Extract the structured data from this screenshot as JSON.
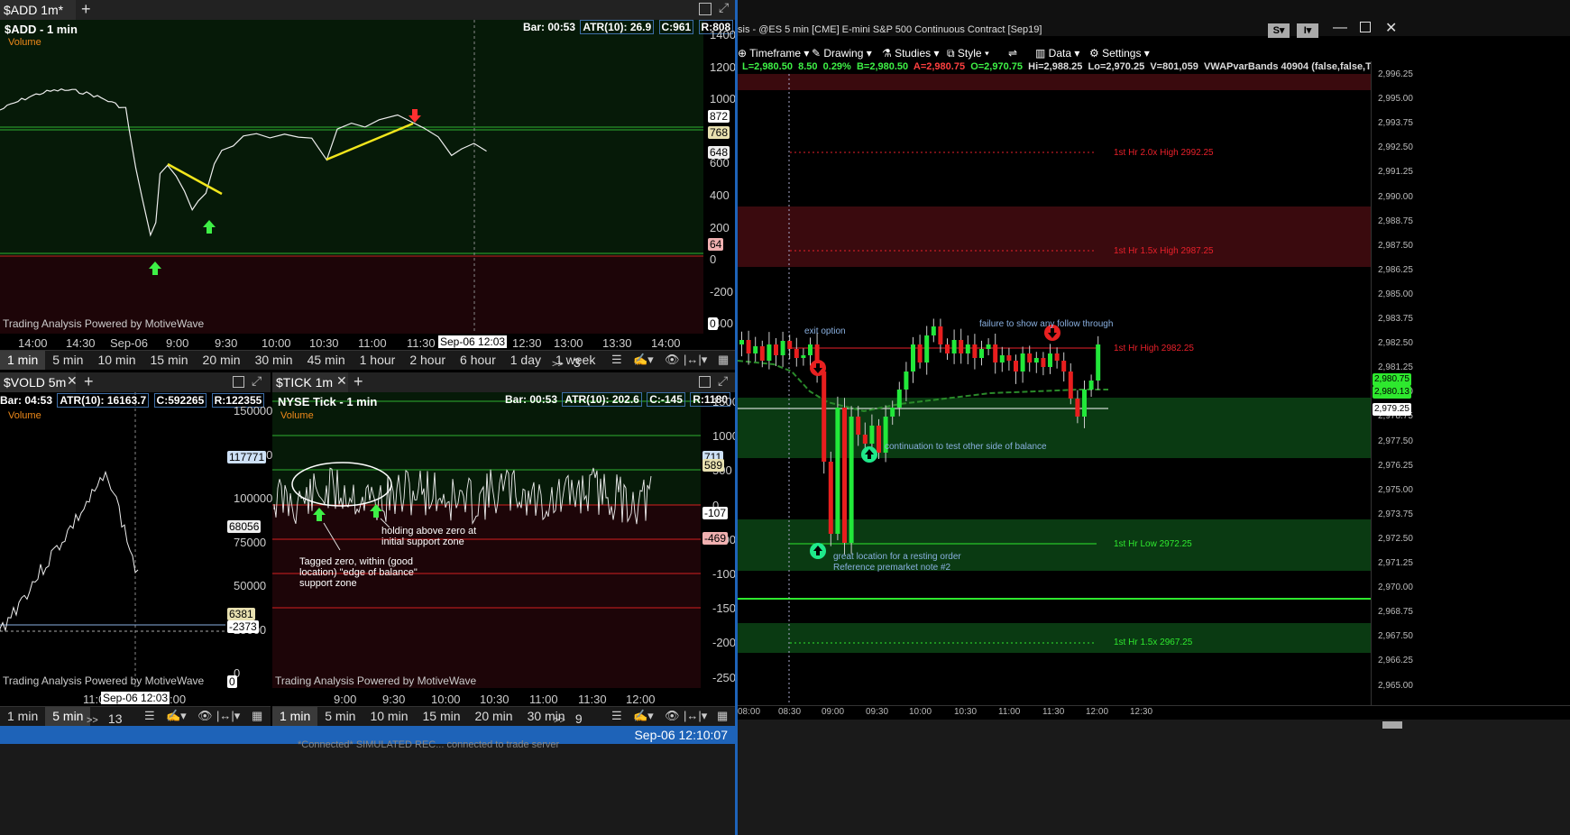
{
  "add_chart": {
    "tab_label": "$ADD 1m*",
    "title": "$ADD - 1 min",
    "volume_label": "Volume",
    "bar_info": "Bar: 00:53",
    "atr": "ATR(10): 26.9",
    "close": "C:961",
    "range": "R:808",
    "y_ticks": [
      "1400",
      "1200",
      "1000",
      "800",
      "600",
      "400",
      "200",
      "0",
      "-200",
      "-400"
    ],
    "tags": [
      "872",
      "768",
      "648",
      "64",
      "0"
    ],
    "x_ticks": [
      "14:00",
      "14:30",
      "Sep-06",
      "9:00",
      "9:30",
      "10:00",
      "10:30",
      "11:00",
      "11:30",
      "12:30",
      "13:00",
      "13:30",
      "14:00"
    ],
    "cursor_time": "Sep-06 12:03",
    "footer": "Trading Analysis Powered by MotiveWave",
    "timeframes": [
      "1 min",
      "5 min",
      "10 min",
      "15 min",
      "20 min",
      "30 min",
      "45 min",
      "1 hour",
      "2 hour",
      "6 hour",
      "1 day",
      "1 week"
    ],
    "more": "3"
  },
  "vold_chart": {
    "tab_label": "$VOLD 5m",
    "title": "$VOLD - 5 min",
    "volume_label": "Volume",
    "bar_info": "Bar: 04:53",
    "atr": "ATR(10): 16163.7",
    "close": "C:592265",
    "range": "R:122355",
    "y_ticks": [
      "150000",
      "125000",
      "100000",
      "75000",
      "50000",
      "25000",
      "0",
      "-25000"
    ],
    "tags": [
      "117771",
      "68056",
      "6381",
      "-2373",
      "0"
    ],
    "x_ticks": [
      "11:0",
      "Sep-06 12:03",
      ":00"
    ],
    "footer": "Trading Analysis Powered by MotiveWave",
    "timeframes": [
      "1 min",
      "5 min"
    ],
    "more": "13"
  },
  "tick_chart": {
    "tab_label": "$TICK 1m",
    "title": "NYSE Tick - 1 min",
    "volume_label": "Volume",
    "bar_info": "Bar: 00:53",
    "atr": "ATR(10): 202.6",
    "close": "C:-145",
    "range": "R:1180",
    "y_ticks": [
      "1500",
      "1000",
      "500",
      "0",
      "-500",
      "-1000",
      "-1500",
      "-2000",
      "-2500"
    ],
    "tags": [
      "711",
      "589",
      "-107",
      "-469"
    ],
    "x_ticks": [
      "9:00",
      "9:30",
      "10:00",
      "10:30",
      "11:00",
      "11:30",
      "12:00"
    ],
    "note1": "Tagged zero, within (good location) \"edge of balance\" support zone",
    "note2": "holding above zero at initial support zone",
    "footer": "Trading Analysis Powered by MotiveWave",
    "timeframes": [
      "1 min",
      "5 min",
      "10 min",
      "15 min",
      "20 min",
      "30 min"
    ],
    "more": "9"
  },
  "es_chart": {
    "title": "sis - @ES 5 min [CME] E-mini S&P 500 Continuous Contract [Sep19]",
    "toolbar": [
      "Timeframe",
      "Drawing",
      "Studies",
      "Style",
      "Data",
      "Settings"
    ],
    "quote": {
      "last": "L=2,980.50",
      "chg": "8.50",
      "pct": "0.29%",
      "bid": "B=2,980.50",
      "ask": "A=2,980.75",
      "open": "O=2,970.75",
      "high": "Hi=2,988.25",
      "low": "Lo=2,970.25",
      "vol": "V=801,059",
      "study": "VWAPvarBands 40904 (false,false,True,true,..."
    },
    "y_ticks": [
      "2,996.25",
      "2,995.00",
      "2,993.75",
      "2,992.50",
      "2,991.25",
      "2,990.00",
      "2,988.75",
      "2,987.50",
      "2,986.25",
      "2,985.00",
      "2,983.75",
      "2,982.50",
      "2,981.25",
      "2,980.00",
      "2,978.75",
      "2,977.50",
      "2,976.25",
      "2,975.00",
      "2,973.75",
      "2,972.50",
      "2,971.25",
      "2,970.00",
      "2,968.75",
      "2,967.50",
      "2,966.25",
      "2,965.00"
    ],
    "tags": [
      "2,980.75",
      "2,980.13",
      "2,979.25"
    ],
    "x_ticks": [
      "08:00",
      "08:30",
      "09:00",
      "09:30",
      "10:00",
      "10:30",
      "11:00",
      "11:30",
      "12:00",
      "12:30"
    ],
    "levels": [
      "1st Hr 2.0x High 2992.25",
      "1st Hr 1.5x High 2987.25",
      "1st Hr High 2982.25",
      "1st Hr Low 2972.25",
      "1st Hr 1.5x 2967.25"
    ],
    "notes": {
      "exit": "exit option",
      "failure": "failure to show any follow through",
      "continuation": "continuation to test other side of balance",
      "great": "great location for a resting order",
      "reference": "Reference premarket note #2"
    },
    "buttons": [
      "S",
      "I"
    ]
  },
  "status": {
    "datetime": "Sep-06 12:10:07",
    "log": "*Connected* SIMULATED REC... connected to trade server"
  },
  "colors": {
    "green_zone": "#0a3a12",
    "red_zone": "#3a0a0e",
    "level_red": "#e8202a",
    "level_green": "#2ee82e",
    "accent": "#1e63b8"
  }
}
